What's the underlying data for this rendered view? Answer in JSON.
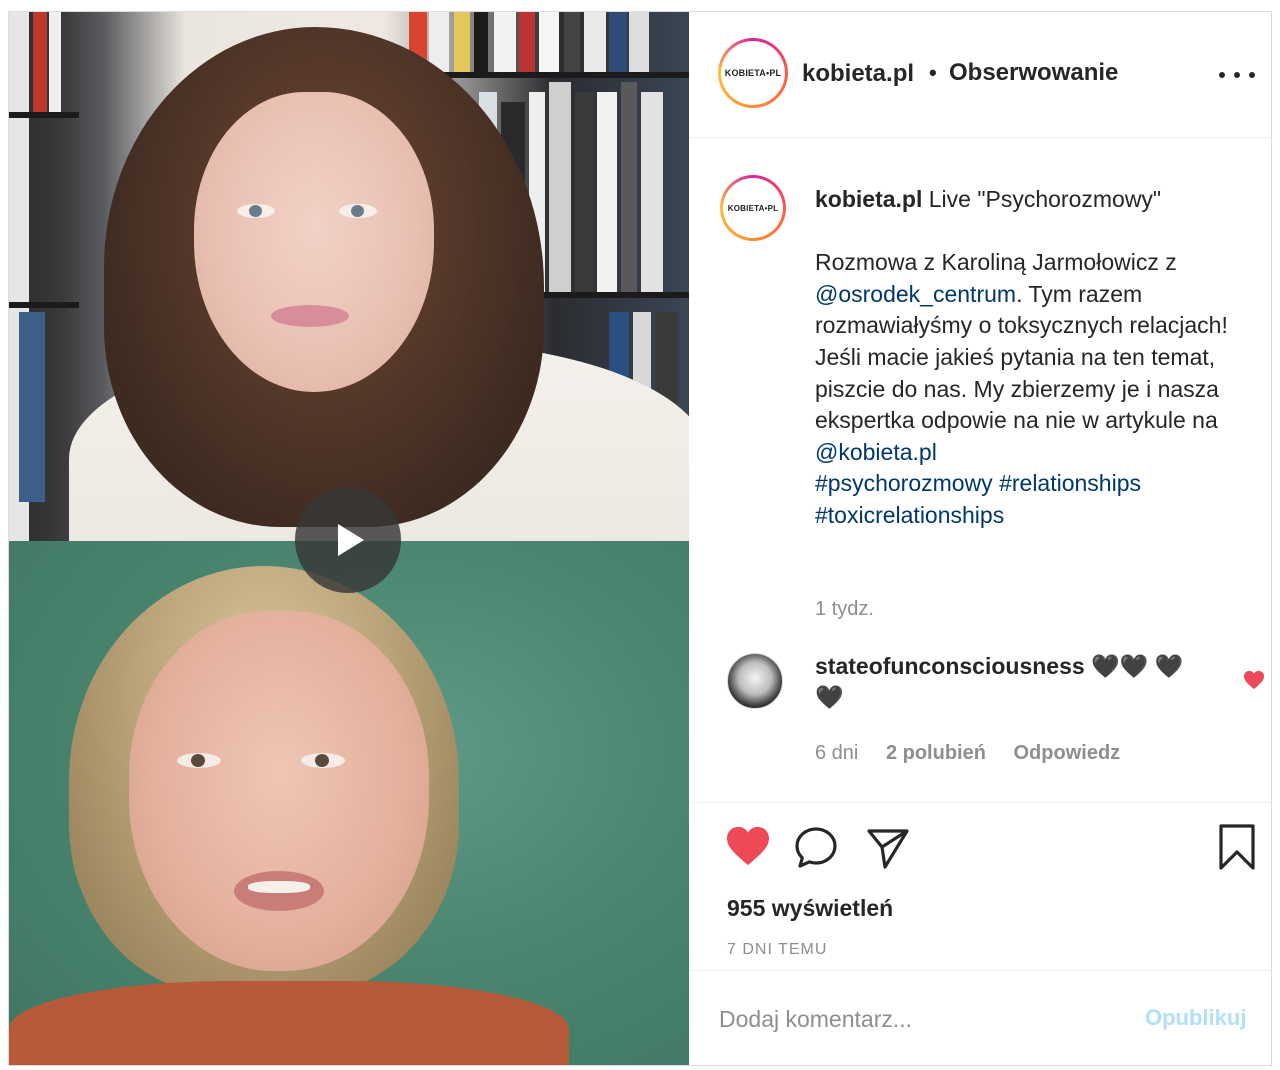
{
  "post": {
    "account": "kobieta.pl",
    "avatar_logo": "KOBIETA•PL",
    "follow_dot": "•",
    "follow_label": "Obserwowanie",
    "more_icon": "more-horizontal-icon"
  },
  "media": {
    "play_icon": "play-icon"
  },
  "caption": {
    "user": "kobieta.pl",
    "title": " Live \"Psychorozmowy\"",
    "p1": "Rozmowa z Karoliną Jarmołowicz z ",
    "mention1": "@osrodek_centrum",
    "p2": ". Tym razem rozmawiałyśmy o toksycznych relacjach!",
    "p3": "Jeśli macie jakieś pytania na ten temat, piszcie do nas. My zbierzemy je i nasza ekspertka odpowie na nie w artykule na ",
    "mention2": "@kobieta.pl",
    "tag1": "#psychorozmowy",
    "tag2": "#relationships",
    "tag3": "#toxicrelationships",
    "time": "1 tydz."
  },
  "comment": {
    "user": "stateofunconsciousness",
    "text": "🖤🖤 🖤🖤",
    "time": "6 dni",
    "likes": "2 polubień",
    "reply": "Odpowiedz",
    "liked": true,
    "like_color": "#ed4956"
  },
  "actions": {
    "liked": true,
    "like_color": "#ed4956",
    "views": "955 wyświetleń",
    "posted": "7 DNI TEMU"
  },
  "add_comment": {
    "placeholder": "Dodaj komentarz...",
    "publish": "Opublikuj",
    "publish_color": "#b2dffc"
  }
}
